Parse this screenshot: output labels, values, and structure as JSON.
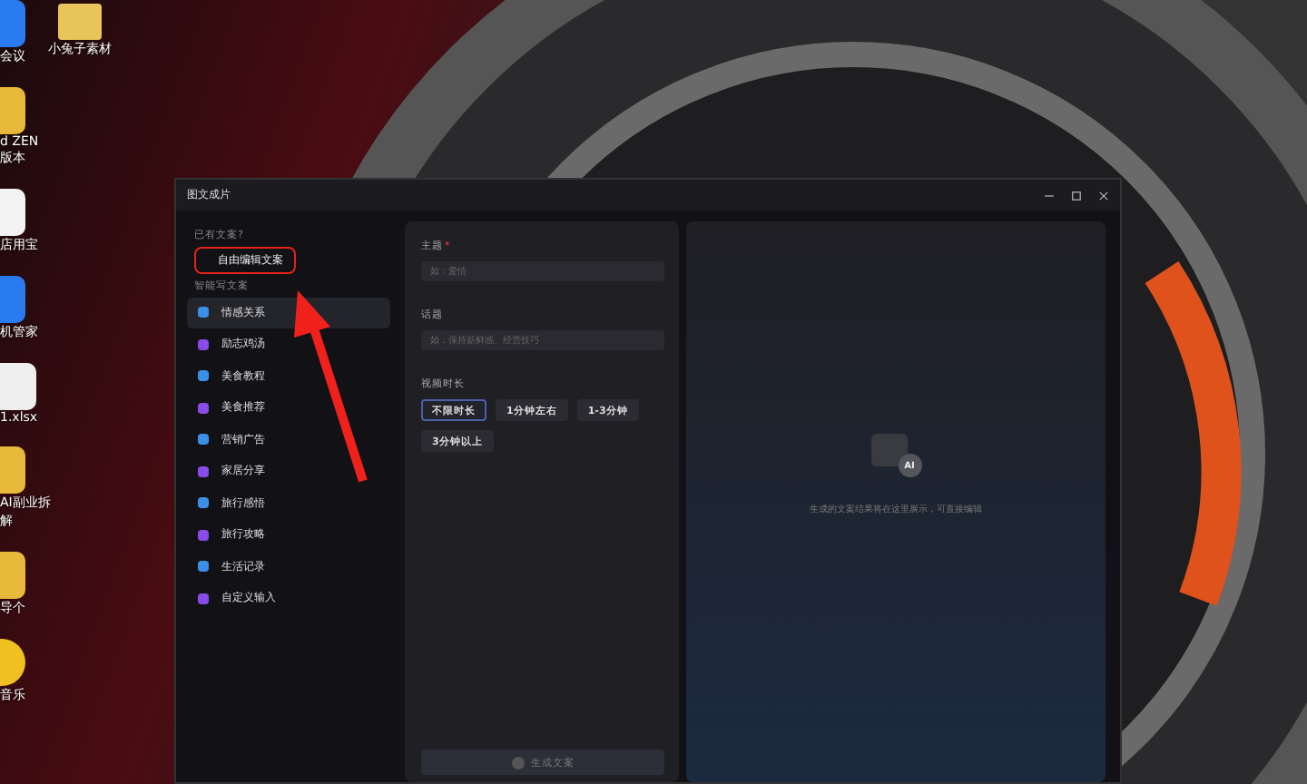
{
  "desktop": {
    "icons": [
      {
        "label": "会议"
      },
      {
        "label": "d ZEN 版本"
      },
      {
        "label": "店用宝"
      },
      {
        "label": "机管家"
      },
      {
        "label": "1.xlsx"
      },
      {
        "label": "AI副业拆解"
      },
      {
        "label": "导个"
      },
      {
        "label": "音乐"
      }
    ],
    "folder": {
      "label": "小兔子素材"
    }
  },
  "window": {
    "title": "图文成片",
    "sidebar": {
      "existing_heading": "已有文案?",
      "free_edit": {
        "label": "自由编辑文案",
        "highlighted": true
      },
      "smart_heading": "智能写文案",
      "items": [
        {
          "label": "情感关系",
          "selected": true
        },
        {
          "label": "励志鸡汤",
          "selected": false
        },
        {
          "label": "美食教程",
          "selected": false
        },
        {
          "label": "美食推荐",
          "selected": false
        },
        {
          "label": "营销广告",
          "selected": false
        },
        {
          "label": "家居分享",
          "selected": false
        },
        {
          "label": "旅行感悟",
          "selected": false
        },
        {
          "label": "旅行攻略",
          "selected": false
        },
        {
          "label": "生活记录",
          "selected": false
        },
        {
          "label": "自定义输入",
          "selected": false
        }
      ]
    },
    "form": {
      "theme_label": "主题",
      "required_mark": "*",
      "theme_placeholder": "如：爱情",
      "topic_label": "话题",
      "topic_placeholder": "如：保持新鲜感、经营技巧",
      "duration_label": "视频时长",
      "durations": [
        {
          "label": "不限时长",
          "selected": true
        },
        {
          "label": "1分钟左右",
          "selected": false
        },
        {
          "label": "1-3分钟",
          "selected": false
        },
        {
          "label": "3分钟以上",
          "selected": false
        }
      ],
      "generate_button": {
        "label": "生成文案",
        "disabled": true
      }
    },
    "result": {
      "badge": "AI",
      "hint": "生成的文案结果将在这里展示，可直接编辑"
    }
  }
}
